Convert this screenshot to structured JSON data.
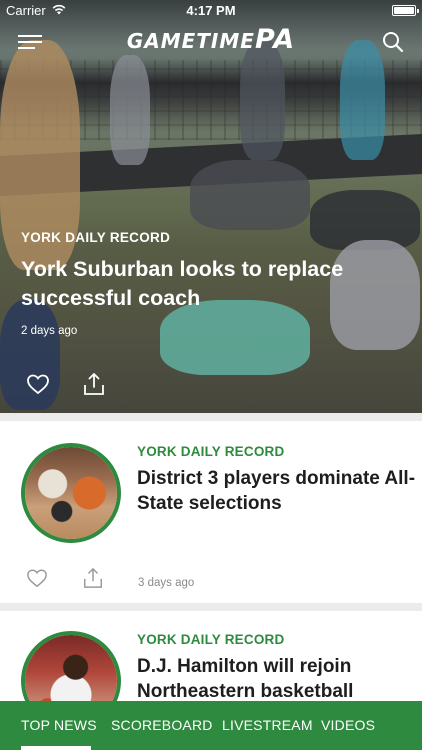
{
  "status_bar": {
    "carrier": "Carrier",
    "time": "4:17 PM"
  },
  "header": {
    "logo_part1": "Gametime",
    "logo_part2": "PA"
  },
  "hero": {
    "source": "YORK DAILY RECORD",
    "title": "York Suburban looks to replace successful coach",
    "date": "2 days ago"
  },
  "articles": [
    {
      "source": "YORK DAILY RECORD",
      "title": "District 3 players dominate All-State selections",
      "date": "3 days ago"
    },
    {
      "source": "YORK DAILY RECORD",
      "title": "D.J. Hamilton will rejoin Northeastern basketball"
    }
  ],
  "tabs": [
    {
      "label": "TOP NEWS",
      "active": true
    },
    {
      "label": "SCOREBOARD",
      "active": false
    },
    {
      "label": "LIVESTREAM",
      "active": false
    },
    {
      "label": "VIDEOS",
      "active": false
    }
  ],
  "colors": {
    "brand_green": "#2e8a3e",
    "text_dark": "#1e1e1e",
    "meta_gray": "#8a8a8a"
  },
  "icons": [
    "wifi-icon",
    "battery-icon",
    "menu-icon",
    "search-icon",
    "heart-icon",
    "share-icon"
  ]
}
